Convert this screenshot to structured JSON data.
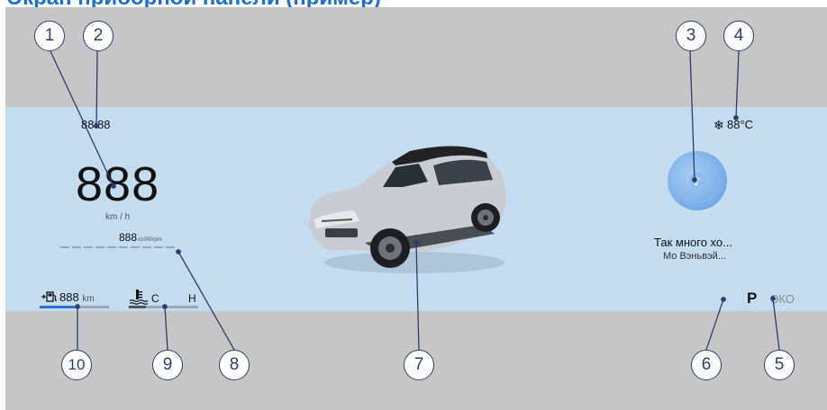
{
  "header_text": "Экран приборной панели (пример)",
  "clock": "88:88",
  "speed": {
    "value": "888",
    "unit": "km / h"
  },
  "rpm": {
    "value": "888",
    "unit": "x1000rpm"
  },
  "fuel": {
    "icon": "fuel-pump-icon",
    "value": "888",
    "unit": "km",
    "level": 0.5
  },
  "coolant": {
    "icon": "coolant-temperature-icon",
    "low_label": "C",
    "high_label": "H",
    "level": 0.25
  },
  "climate": {
    "icon": "snowflake-icon",
    "temperature": "88°C"
  },
  "media": {
    "icon": "music-disc-icon",
    "title": "Так много хо...",
    "artist": "Мо Вэньвэй..."
  },
  "gear": {
    "current": "P",
    "mode": "ЭКО"
  },
  "callouts": [
    "1",
    "2",
    "3",
    "4",
    "5",
    "6",
    "7",
    "8",
    "9",
    "10"
  ],
  "colors": {
    "band": "#c4dcf0",
    "gray": "#c6c6c6",
    "accent": "#2f6fd0",
    "callout": "#2c3e6e"
  }
}
